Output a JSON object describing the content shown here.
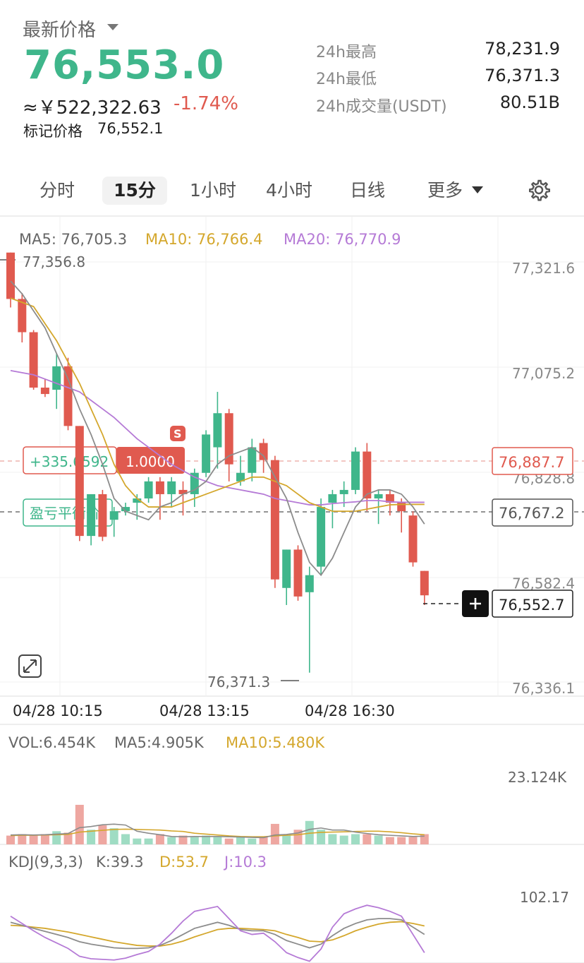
{
  "header": {
    "label": "最新价格",
    "price": "76,553.0",
    "cny": "≈￥522,322.63",
    "change": "-1.74%",
    "mark_label": "标记价格",
    "mark_value": "76,552.1"
  },
  "stats": [
    {
      "label": "24h最高",
      "value": "78,231.9"
    },
    {
      "label": "24h最低",
      "value": "76,371.3"
    },
    {
      "label": "24h成交量(USDT)",
      "value": "80.51B"
    }
  ],
  "tabs": [
    "分时",
    "15分",
    "1小时",
    "4小时",
    "日线",
    "更多"
  ],
  "active_tab": "15分",
  "colors": {
    "up": "#3fb68b",
    "down": "#e05a4f",
    "ma5": "#8c8c8c",
    "ma10": "#d4a72c",
    "ma20": "#b57ad6"
  },
  "main_legend": {
    "ma5": "MA5: 76,705.3",
    "ma10": "MA10: 76,766.4",
    "ma20": "MA20: 76,770.9"
  },
  "price_axis": [
    "77,321.6",
    "77,075.2",
    "76,828.8",
    "76,582.4",
    "76,336.1"
  ],
  "high_marker": "77,356.8",
  "low_marker": "76,371.3",
  "position": {
    "pnl": "+335.6592",
    "size": "1.0000",
    "tag": "S",
    "price": "76,887.7"
  },
  "breakeven": {
    "label": "盈亏平衡价",
    "price": "76,767.2"
  },
  "last_price": "76,552.7",
  "time_axis": [
    "04/28 10:15",
    "04/28 13:15",
    "04/28 16:30"
  ],
  "vol_legend": {
    "vol": "VOL:6.454K",
    "ma5": "MA5:4.905K",
    "ma10": "MA10:5.480K",
    "max": "23.124K"
  },
  "kdj_legend": {
    "name": "KDJ(9,3,3)",
    "k": "K:39.3",
    "d": "D:53.7",
    "j": "J:10.3",
    "max": "102.17"
  },
  "chart_data": {
    "type": "candlestick",
    "interval": "15分",
    "yaxis_ticks": [
      77321.6,
      77075.2,
      76828.8,
      76582.4,
      76336.1
    ],
    "ohlc": [
      [
        77356.8,
        77356.8,
        77228.0,
        77248.0
      ],
      [
        77248.0,
        77262.0,
        77146.0,
        77170.0
      ],
      [
        77170.0,
        77175.0,
        77035.0,
        77040.0
      ],
      [
        77040.0,
        77060.0,
        77018.0,
        77025.0
      ],
      [
        77035.0,
        77120.0,
        76990.0,
        77090.0
      ],
      [
        77090.0,
        77110.0,
        76940.0,
        76950.0
      ],
      [
        76950.0,
        76950.0,
        76680.0,
        76692.0
      ],
      [
        76692.0,
        76790.0,
        76670.0,
        76790.0
      ],
      [
        76790.0,
        76800.0,
        76680.0,
        76690.0
      ],
      [
        76730.0,
        76760.0,
        76690.0,
        76750.0
      ],
      [
        76750.0,
        76770.0,
        76740.0,
        76760.0
      ],
      [
        76770.0,
        76790.0,
        76730.0,
        76780.0
      ],
      [
        76780.0,
        76830.0,
        76770.0,
        76820.0
      ],
      [
        76820.0,
        76830.0,
        76730.0,
        76790.0
      ],
      [
        76790.0,
        76830.0,
        76760.0,
        76820.0
      ],
      [
        76800.0,
        76820.0,
        76740.0,
        76790.0
      ],
      [
        76790.0,
        76850.0,
        76760.0,
        76840.0
      ],
      [
        76840.0,
        76940.0,
        76830.0,
        76930.0
      ],
      [
        76900.0,
        77030.0,
        76850.0,
        76980.0
      ],
      [
        76980.0,
        76990.0,
        76820.0,
        76860.0
      ],
      [
        76820.0,
        76880.0,
        76810.0,
        76840.0
      ],
      [
        76840.0,
        76920.0,
        76820.0,
        76900.0
      ],
      [
        76910.0,
        76920.0,
        76840.0,
        76870.0
      ],
      [
        76870.0,
        76880.0,
        76570.0,
        76590.0
      ],
      [
        76570.0,
        76660.0,
        76530.0,
        76660.0
      ],
      [
        76660.0,
        76670.0,
        76540.0,
        76550.0
      ],
      [
        76560.0,
        76620.0,
        76371.3,
        76600.0
      ],
      [
        76620.0,
        76780.0,
        76600.0,
        76760.0
      ],
      [
        76770.0,
        76800.0,
        76710.0,
        76790.0
      ],
      [
        76790.0,
        76820.0,
        76760.0,
        76800.0
      ],
      [
        76800.0,
        76900.0,
        76790.0,
        76890.0
      ],
      [
        76890.0,
        76910.0,
        76750.0,
        76780.0
      ],
      [
        76780.0,
        76800.0,
        76720.0,
        76790.0
      ],
      [
        76790.0,
        76800.0,
        76740.0,
        76770.0
      ],
      [
        76770.0,
        76780.0,
        76700.0,
        76750.0
      ],
      [
        76740.0,
        76750.0,
        76620.0,
        76630.0
      ],
      [
        76610.0,
        76610.0,
        76530.0,
        76552.7
      ]
    ],
    "ma5": [
      77290,
      77260,
      77220,
      77180,
      77120,
      77060,
      76990,
      76930,
      76860,
      76780,
      76750,
      76740,
      76730,
      76760,
      76770,
      76790,
      76800,
      76820,
      76860,
      76880,
      76890,
      76900,
      76880,
      76830,
      76780,
      76700,
      76630,
      76600,
      76640,
      76700,
      76760,
      76790,
      76800,
      76800,
      76790,
      76760,
      76720
    ],
    "ma10": [
      77250,
      77240,
      77230,
      77190,
      77150,
      77100,
      77050,
      76990,
      76930,
      76860,
      76810,
      76780,
      76760,
      76760,
      76760,
      76770,
      76780,
      76790,
      76800,
      76810,
      76820,
      76830,
      76830,
      76820,
      76810,
      76790,
      76770,
      76760,
      76750,
      76750,
      76750,
      76755,
      76760,
      76765,
      76766,
      76766,
      76766
    ],
    "ma20": [
      77080,
      77075,
      77070,
      77060,
      77050,
      77040,
      77030,
      77010,
      76990,
      76970,
      76945,
      76920,
      76900,
      76880,
      76860,
      76845,
      76830,
      76820,
      76810,
      76805,
      76800,
      76795,
      76790,
      76780,
      76775,
      76770,
      76765,
      76765,
      76768,
      76770,
      76772,
      76775,
      76775,
      76772,
      76771,
      76771,
      76771
    ],
    "volume_max": 23124,
    "volume": [
      3.0,
      3.5,
      3.0,
      3.5,
      4.5,
      4.0,
      13.5,
      5.0,
      6.5,
      5.5,
      3.5,
      2.0,
      2.0,
      3.5,
      2.5,
      3.0,
      2.5,
      3.0,
      2.5,
      2.0,
      2.5,
      2.0,
      2.5,
      7.0,
      3.0,
      5.0,
      8.0,
      5.0,
      3.5,
      3.0,
      3.5,
      3.5,
      3.0,
      2.5,
      2.5,
      2.5,
      3.5
    ],
    "vol_ma5": [
      3.2,
      3.3,
      3.2,
      3.3,
      3.5,
      3.7,
      5.7,
      6.1,
      6.7,
      6.9,
      6.6,
      4.5,
      3.8,
      3.3,
      2.7,
      2.6,
      2.7,
      2.7,
      2.7,
      2.6,
      2.5,
      2.4,
      2.3,
      3.2,
      3.4,
      3.9,
      5.1,
      5.6,
      4.9,
      4.9,
      4.2,
      3.7,
      3.3,
      3.1,
      2.9,
      2.7,
      2.8
    ],
    "vol_ma10": [
      3.0,
      3.1,
      3.1,
      3.2,
      3.3,
      3.4,
      4.2,
      4.5,
      4.8,
      5.1,
      5.2,
      5.1,
      5.0,
      4.9,
      4.6,
      4.4,
      3.8,
      3.5,
      3.2,
      2.9,
      2.7,
      2.6,
      2.6,
      2.9,
      3.1,
      3.3,
      3.8,
      4.1,
      4.2,
      4.3,
      4.4,
      4.5,
      4.5,
      4.3,
      4.0,
      3.6,
      3.3
    ],
    "kdj_max": 102.17,
    "k": [
      60,
      55,
      50,
      45,
      40,
      35,
      28,
      24,
      21,
      18,
      17,
      17,
      18,
      22,
      30,
      40,
      50,
      55,
      60,
      55,
      48,
      46,
      46,
      40,
      30,
      24,
      18,
      24,
      38,
      50,
      58,
      64,
      66,
      66,
      64,
      52,
      40
    ],
    "d": [
      55,
      54,
      52,
      50,
      47,
      44,
      40,
      36,
      32,
      28,
      25,
      22,
      21,
      21,
      24,
      29,
      36,
      42,
      48,
      50,
      50,
      49,
      48,
      46,
      40,
      35,
      29,
      28,
      31,
      38,
      46,
      52,
      57,
      60,
      61,
      58,
      54
    ],
    "j": [
      70,
      58,
      46,
      35,
      26,
      17,
      4,
      0,
      -1,
      -2,
      1,
      7,
      12,
      24,
      42,
      62,
      78,
      82,
      86,
      66,
      46,
      40,
      42,
      28,
      10,
      2,
      -4,
      16,
      52,
      74,
      82,
      88,
      84,
      78,
      70,
      40,
      10
    ]
  }
}
